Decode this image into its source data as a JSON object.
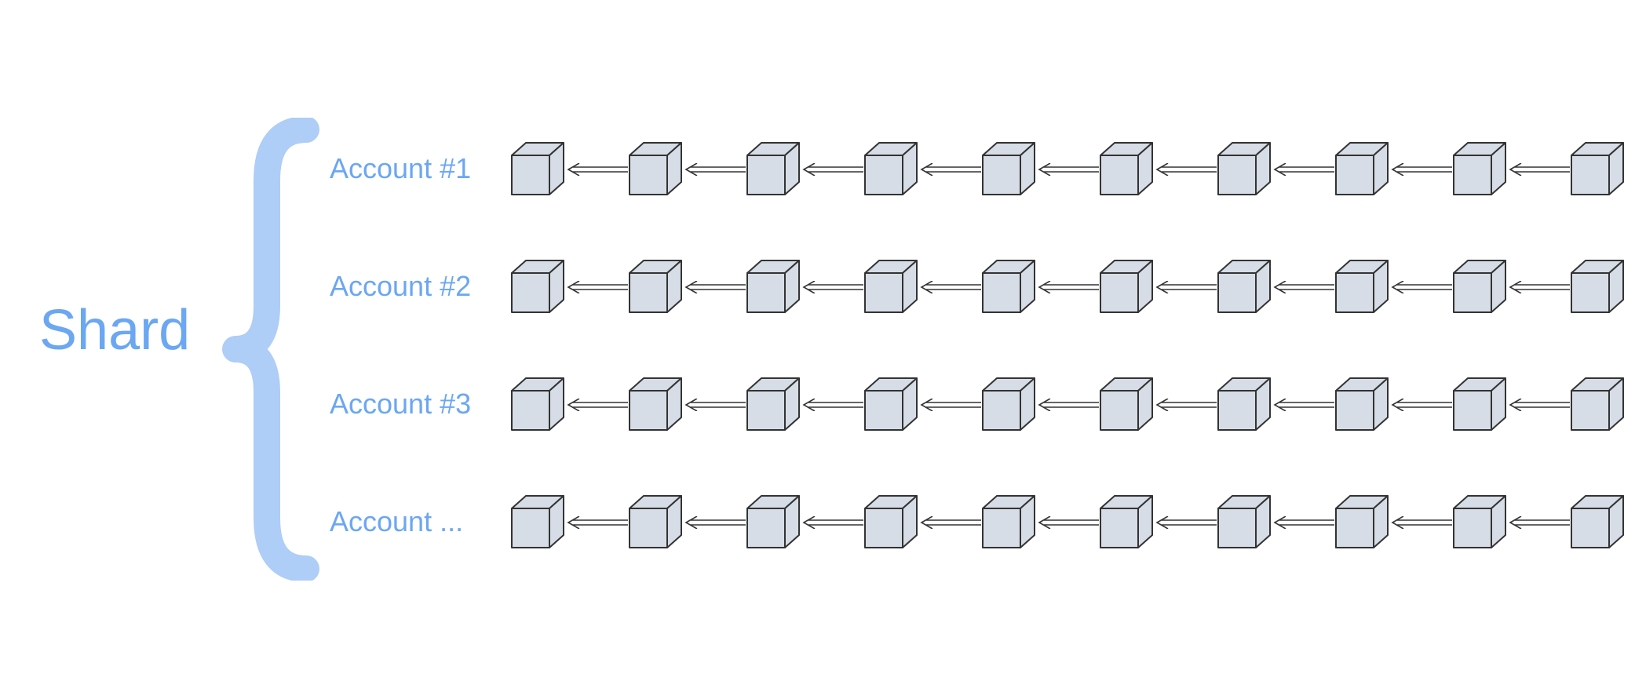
{
  "title": "Shard",
  "rows": [
    {
      "label": "Account #1",
      "blocks": 10
    },
    {
      "label": "Account #2",
      "blocks": 10
    },
    {
      "label": "Account #3",
      "blocks": 10
    },
    {
      "label": "Account ...",
      "blocks": 10
    }
  ],
  "colors": {
    "label": "#6BA7F2",
    "brace": "#AECDF7",
    "cubeFill": "#D6DDE6",
    "cubeStroke": "#333333"
  }
}
